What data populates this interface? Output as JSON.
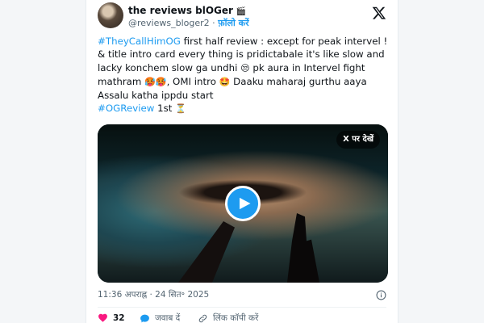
{
  "tweet": {
    "author_name": "the reviews blOGer",
    "author_emoji": "🎬",
    "handle": "@reviews_bloger2",
    "separator": "·",
    "follow_label": "फ़ॉलो करें",
    "text": {
      "hashtag1": "#TheyCallHimOG",
      "part1": " first half review : except for peak intervel ! & title intro card every thing is pridictabale it's like slow and lacky konchem slow ga undhi ",
      "emoji1": "😒",
      "part2": " pk aura in Intervel fight mathram ",
      "emoji2": "🥵🥵",
      "part3": ", OMI intro ",
      "emoji3": "🤩",
      "part4": " Daaku maharaj gurthu aaya Assalu katha ippdu start",
      "hashtag2": "#OGReview",
      "part5": " 1st ",
      "emoji4": "⏳"
    },
    "media": {
      "view_on_x_label": "X पर देखें"
    },
    "timestamp": "11:36 अपराह्न · 24 सित॰ 2025",
    "likes": "32",
    "reply_label": "जवाब दें",
    "copy_link_label": "लिंक कॉपी करें"
  },
  "colors": {
    "accent": "#1d9bf0",
    "like": "#f91880",
    "text": "#0f1419",
    "muted": "#536471"
  },
  "icons": [
    "x-logo-icon",
    "play-icon",
    "info-icon",
    "heart-icon",
    "reply-icon",
    "link-icon"
  ]
}
